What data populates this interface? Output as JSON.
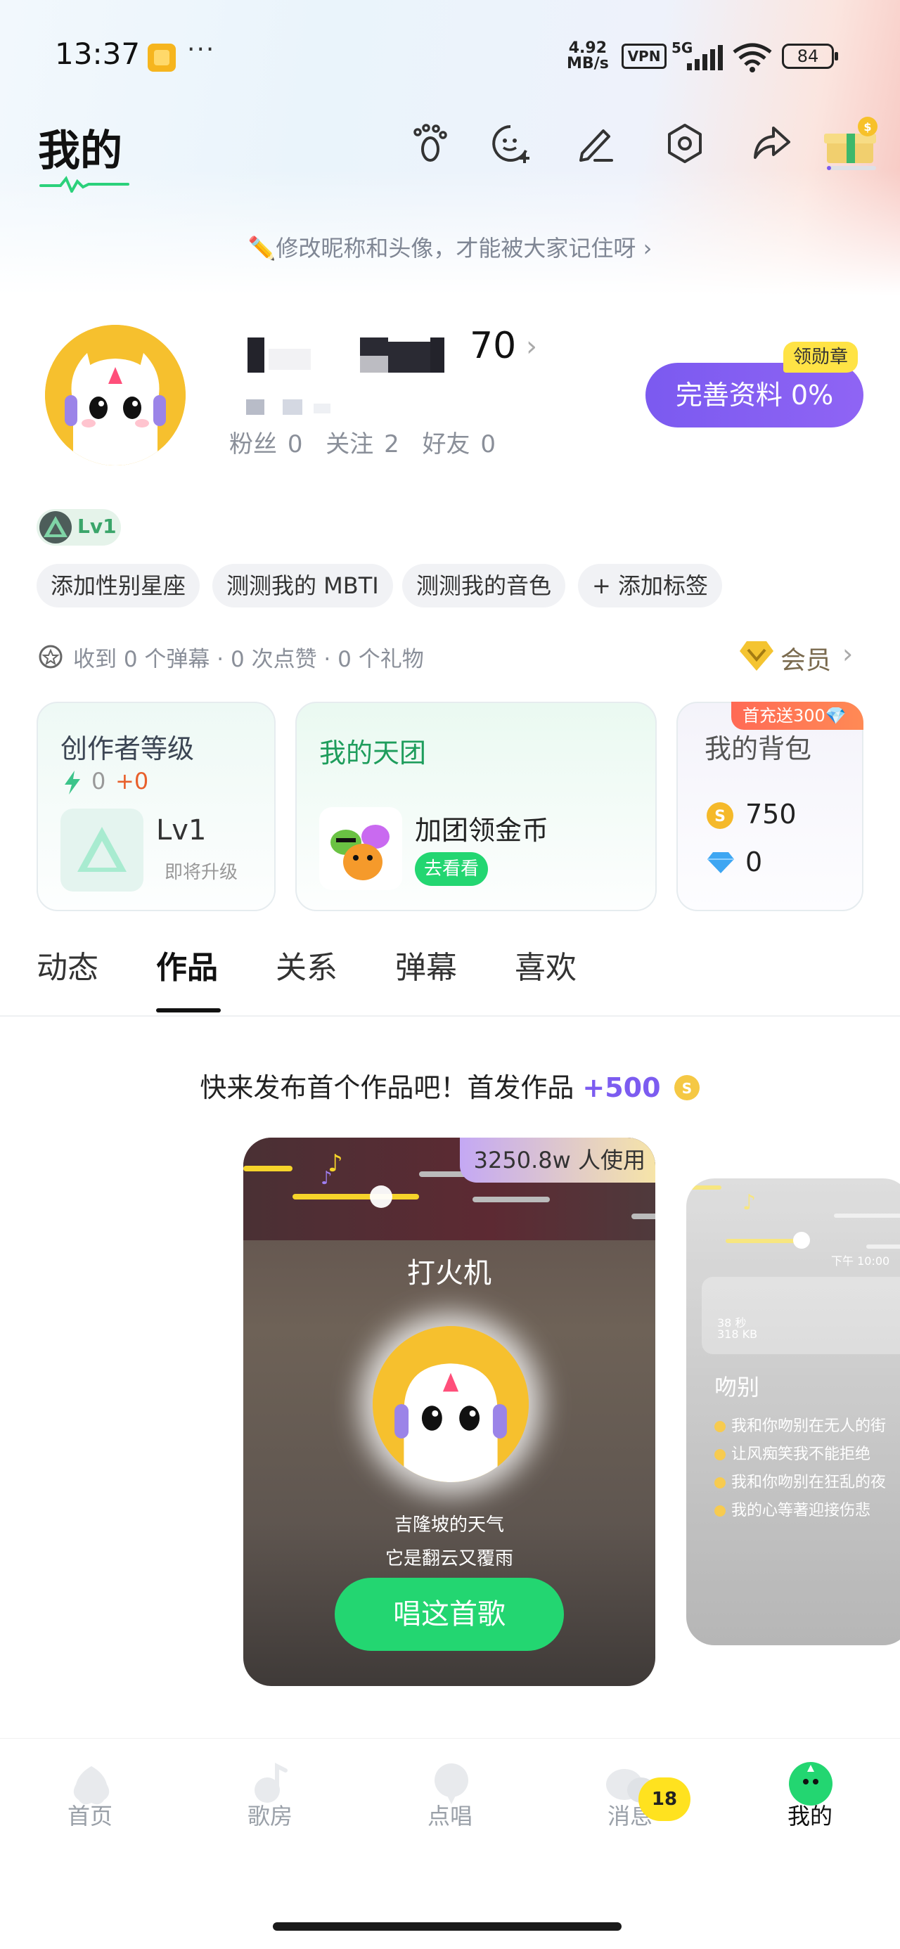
{
  "status_bar": {
    "time": "13:37",
    "more": "···",
    "speed_value": "4.92",
    "speed_unit": "MB/s",
    "vpn": "VPN",
    "network": "5G",
    "battery": "84"
  },
  "header": {
    "title": "我的",
    "tip": "✏️修改昵称和头像，才能被大家记住呀 ›",
    "icons": [
      "footprint-icon",
      "add-friend-icon",
      "edit-icon",
      "settings-icon",
      "share-icon",
      "gift-box-icon"
    ]
  },
  "profile": {
    "name_suffix": "70",
    "name_arrow": "›",
    "fans_label": "粉丝",
    "fans_count": "0",
    "following_label": "关注",
    "following_count": "2",
    "friends_label": "好友",
    "friends_count": "0",
    "complete_button": "完善资料 0%",
    "medal_badge": "领勋章",
    "level": "Lv1"
  },
  "tags": [
    "添加性别星座",
    "测测我的 MBTI",
    "测测我的音色",
    "+ 添加标签"
  ],
  "received": {
    "text": "收到 0 个弹幕 · 0 次点赞 · 0 个礼物",
    "vip_label": "会员",
    "vip_arrow": "›"
  },
  "cards": {
    "creator": {
      "title": "创作者等级",
      "points": "0",
      "points_delta": "+0",
      "level": "Lv1",
      "hint": "即将升级"
    },
    "team": {
      "title": "我的天团",
      "text": "加团领金币",
      "button": "去看看"
    },
    "backpack": {
      "title": "我的背包",
      "badge": "首充送300💎",
      "coins": "750",
      "diamonds": "0"
    }
  },
  "tabs": [
    {
      "label": "动态",
      "active": false
    },
    {
      "label": "作品",
      "active": true
    },
    {
      "label": "关系",
      "active": false
    },
    {
      "label": "弹幕",
      "active": false
    },
    {
      "label": "喜欢",
      "active": false
    }
  ],
  "promo": {
    "text": "快来发布首个作品吧！首发作品 ",
    "bonus": "+500"
  },
  "song_card": {
    "users_badge": "3250.8w 人使用",
    "title": "打火机",
    "lyric1": "吉隆坡的天气",
    "lyric2": "它是翻云又覆雨",
    "sing_button": "唱这首歌"
  },
  "song_card2": {
    "title": "吻别",
    "lines": [
      "我和你吻别在无人的街",
      "让风痴笑我不能拒绝",
      "我和你吻别在狂乱的夜",
      "我的心等著迎接伤悲"
    ],
    "meta1": "38 秒",
    "meta2": "318 KB",
    "meta3": "下午 10:00"
  },
  "bottom_nav": [
    {
      "label": "首页",
      "icon": "home-icon",
      "active": false
    },
    {
      "label": "歌房",
      "icon": "music-room-icon",
      "active": false
    },
    {
      "label": "点唱",
      "icon": "mic-icon",
      "active": false
    },
    {
      "label": "消息",
      "icon": "message-icon",
      "active": false,
      "badge": "18"
    },
    {
      "label": "我的",
      "icon": "profile-icon",
      "active": true
    }
  ],
  "colors": {
    "accent_green": "#23d671",
    "accent_purple": "#7b5af0",
    "badge_yellow": "#ffe21f"
  }
}
